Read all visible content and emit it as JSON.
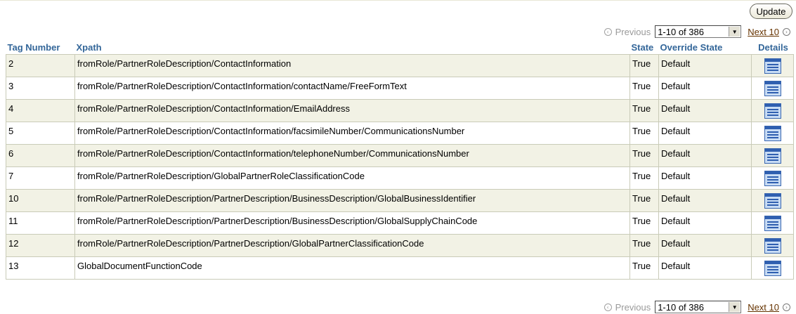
{
  "actions": {
    "update_label": "Update"
  },
  "pagination": {
    "previous_label": "Previous",
    "range": "1-10 of 386",
    "next_label": "Next 10"
  },
  "table": {
    "columns": [
      "Tag Number",
      "Xpath",
      "State",
      "Override State",
      "Details"
    ],
    "rows": [
      {
        "tag": "2",
        "xpath": "fromRole/PartnerRoleDescription/ContactInformation",
        "state": "True",
        "override": "Default"
      },
      {
        "tag": "3",
        "xpath": "fromRole/PartnerRoleDescription/ContactInformation/contactName/FreeFormText",
        "state": "True",
        "override": "Default"
      },
      {
        "tag": "4",
        "xpath": "fromRole/PartnerRoleDescription/ContactInformation/EmailAddress",
        "state": "True",
        "override": "Default"
      },
      {
        "tag": "5",
        "xpath": "fromRole/PartnerRoleDescription/ContactInformation/facsimileNumber/CommunicationsNumber",
        "state": "True",
        "override": "Default"
      },
      {
        "tag": "6",
        "xpath": "fromRole/PartnerRoleDescription/ContactInformation/telephoneNumber/CommunicationsNumber",
        "state": "True",
        "override": "Default"
      },
      {
        "tag": "7",
        "xpath": "fromRole/PartnerRoleDescription/GlobalPartnerRoleClassificationCode",
        "state": "True",
        "override": "Default"
      },
      {
        "tag": "10",
        "xpath": "fromRole/PartnerRoleDescription/PartnerDescription/BusinessDescription/GlobalBusinessIdentifier",
        "state": "True",
        "override": "Default"
      },
      {
        "tag": "11",
        "xpath": "fromRole/PartnerRoleDescription/PartnerDescription/BusinessDescription/GlobalSupplyChainCode",
        "state": "True",
        "override": "Default"
      },
      {
        "tag": "12",
        "xpath": "fromRole/PartnerRoleDescription/PartnerDescription/GlobalPartnerClassificationCode",
        "state": "True",
        "override": "Default"
      },
      {
        "tag": "13",
        "xpath": "GlobalDocumentFunctionCode",
        "state": "True",
        "override": "Default"
      }
    ]
  },
  "icons": {
    "previous": "chevron-left-circle-icon",
    "next": "chevron-right-circle-icon",
    "dropdown": "dropdown-arrow-icon",
    "details": "details-icon"
  },
  "colors": {
    "header_text": "#336699",
    "row_stripe": "#f2f2e5",
    "link": "#663300",
    "disabled": "#9a9a9a"
  }
}
